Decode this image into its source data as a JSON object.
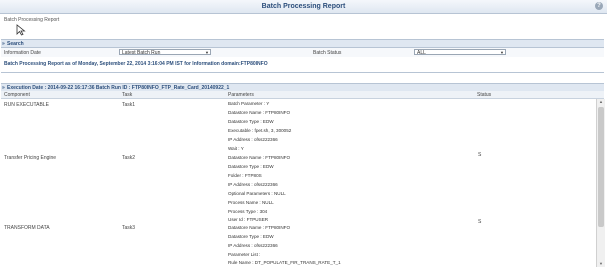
{
  "header": {
    "title": "Batch Processing Report",
    "help_glyph": "?"
  },
  "breadcrumb": "Batch Processing Report",
  "search": {
    "title": "Search",
    "info_date_label": "Information Date",
    "info_date_value": "Latest Batch Run",
    "batch_status_label": "Batch Status",
    "batch_status_value": "ALL"
  },
  "report_line": "Batch Processing Report as of Monday, September 22, 2014 3:16:04 PM IST for Information domain:FTP80INFO",
  "execution": {
    "header": "Execution Date : 2014-09-22 16:17:36    Batch Run ID : FTP80INFO_FTP_Rate_Card_20140922_1"
  },
  "table": {
    "columns": [
      "Component",
      "Task",
      "Parameters",
      "Status"
    ],
    "rows": [
      {
        "component": "RUN EXECUTABLE",
        "task": "Task1",
        "status": "",
        "params": [
          "Batch Parameter : Y",
          "Datastore Name : FTP80INFO",
          "Datastore Type : EDW",
          "Executable : fpet.sh, 3, 300052",
          "IP Address : ofss222366",
          "Wait : Y"
        ]
      },
      {
        "component": "Transfer Pricing Engine",
        "task": "Task2",
        "status": "S",
        "params": [
          "Datastore Name : FTP80INFO",
          "Datastore Type : EDW",
          "Folder : FTP80S",
          "IP Address : ofss222366",
          "Optional Parameters : NULL",
          "Process Name : NULL",
          "Process Type : 304",
          "User Id : FTPUSER"
        ]
      },
      {
        "component": "TRANSFORM DATA",
        "task": "Task3",
        "status": "S",
        "params": [
          "Datastore Name : FTP80INFO",
          "Datastore Type : EDW",
          "IP Address : ofss222366",
          "Parameter List :",
          "Rule Name : DT_POPULATE_FIR_TRANS_RATE_T_1"
        ]
      }
    ]
  }
}
